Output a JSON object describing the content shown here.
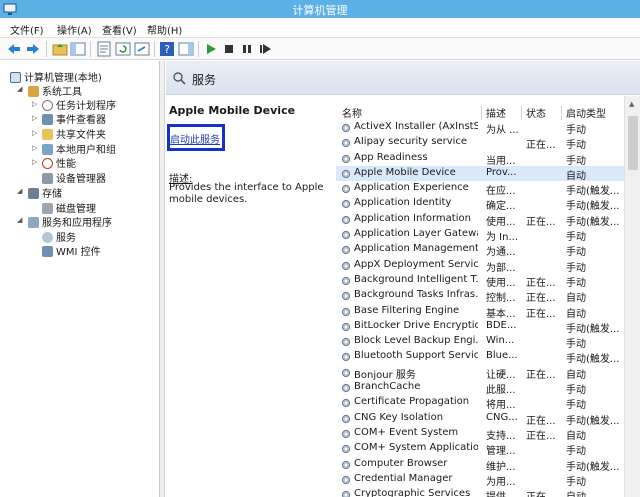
{
  "window": {
    "title": "计算机管理"
  },
  "menu": [
    "文件(F)",
    "操作(A)",
    "查看(V)",
    "帮助(H)"
  ],
  "tree": {
    "root": "计算机管理(本地)",
    "system_tools": "系统工具",
    "task_scheduler": "任务计划程序",
    "event_viewer": "事件查看器",
    "shared_folders": "共享文件夹",
    "local_users": "本地用户和组",
    "performance": "性能",
    "device_manager": "设备管理器",
    "storage": "存储",
    "disk_management": "磁盘管理",
    "services_apps": "服务和应用程序",
    "services": "服务",
    "wmi": "WMI 控件"
  },
  "panel": {
    "title": "服务"
  },
  "details": {
    "service_name": "Apple Mobile Device",
    "start_link": "启动此服务",
    "desc_label": "描述:",
    "desc_text": "Provides the interface to Apple mobile devices."
  },
  "columns": {
    "name": "名称",
    "desc": "描述",
    "status": "状态",
    "startup": "启动类型"
  },
  "services": [
    {
      "name": "ActiveX Installer (AxInstSV)",
      "desc": "为从 ...",
      "status": "",
      "startup": "手动"
    },
    {
      "name": "AIipay security service",
      "desc": "",
      "status": "正在...",
      "startup": "手动"
    },
    {
      "name": "App Readiness",
      "desc": "当用...",
      "status": "",
      "startup": "手动"
    },
    {
      "name": "Apple Mobile Device",
      "desc": "Prov...",
      "status": "",
      "startup": "自动",
      "selected": true
    },
    {
      "name": "Application Experience",
      "desc": "在应...",
      "status": "",
      "startup": "手动(触发..."
    },
    {
      "name": "Application Identity",
      "desc": "确定...",
      "status": "",
      "startup": "手动(触发..."
    },
    {
      "name": "Application Information",
      "desc": "使用...",
      "status": "正在...",
      "startup": "手动(触发..."
    },
    {
      "name": "Application Layer Gatewa...",
      "desc": "为 In...",
      "status": "",
      "startup": "手动"
    },
    {
      "name": "Application Management",
      "desc": "为通...",
      "status": "",
      "startup": "手动"
    },
    {
      "name": "AppX Deployment Servic...",
      "desc": "为部...",
      "status": "",
      "startup": "手动"
    },
    {
      "name": "Background Intelligent T...",
      "desc": "使用...",
      "status": "正在...",
      "startup": "手动"
    },
    {
      "name": "Background Tasks Infras...",
      "desc": "控制...",
      "status": "正在...",
      "startup": "自动"
    },
    {
      "name": "Base Filtering Engine",
      "desc": "基本...",
      "status": "正在...",
      "startup": "自动"
    },
    {
      "name": "BitLocker Drive Encryptio...",
      "desc": "BDE...",
      "status": "",
      "startup": "手动(触发..."
    },
    {
      "name": "Block Level Backup Engi...",
      "desc": "Win...",
      "status": "",
      "startup": "手动"
    },
    {
      "name": "Bluetooth Support Service",
      "desc": "Blue...",
      "status": "",
      "startup": "手动(触发..."
    },
    {
      "name": "Bonjour 服务",
      "desc": "让硬...",
      "status": "正在...",
      "startup": "自动"
    },
    {
      "name": "BranchCache",
      "desc": "此服...",
      "status": "",
      "startup": "手动"
    },
    {
      "name": "Certificate Propagation",
      "desc": "将用...",
      "status": "",
      "startup": "手动"
    },
    {
      "name": "CNG Key Isolation",
      "desc": "CNG...",
      "status": "正在...",
      "startup": "手动(触发..."
    },
    {
      "name": "COM+ Event System",
      "desc": "支持...",
      "status": "正在...",
      "startup": "自动"
    },
    {
      "name": "COM+ System Application",
      "desc": "管理...",
      "status": "",
      "startup": "手动"
    },
    {
      "name": "Computer Browser",
      "desc": "维护...",
      "status": "",
      "startup": "手动(触发..."
    },
    {
      "name": "Credential Manager",
      "desc": "为用...",
      "status": "",
      "startup": "手动"
    },
    {
      "name": "Cryptographic Services",
      "desc": "提供...",
      "status": "正在...",
      "startup": "自动"
    }
  ]
}
